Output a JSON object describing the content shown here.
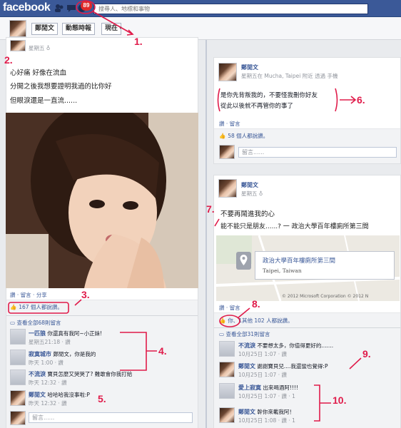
{
  "topbar": {
    "logo": "facebook",
    "notification_count": "89",
    "search_placeholder": "搜尋人、地標和事物"
  },
  "header": {
    "name": "鄭閒文",
    "tabs": [
      "動態時報",
      "現在"
    ]
  },
  "left_post": {
    "date": "星期五",
    "lines": [
      "心好痛 好像在流血",
      "分開之後我想要證明我過的比你好",
      "但眼淚還是一直流......"
    ],
    "actions": [
      "讚",
      "留言",
      "分享"
    ],
    "likes": "167 個人都說讚。",
    "view_all": "查看全部68則留言",
    "comments": [
      {
        "name": "一匹狼",
        "text": "你還真有我阿~小正妹!",
        "time": "星期五21:18 · 讚"
      },
      {
        "name": "寂寞城市",
        "text": "鄭閒文，你是我的",
        "time": "昨天 1:00 · 讚"
      },
      {
        "name": "不流淚",
        "text": "寶貝怎麼又哭哭了? 難敢會你我打給",
        "time": "昨天 12:32 · 讚"
      },
      {
        "name": "鄭閒文",
        "text": "哈哈哈我沒事啦:P",
        "time": "昨天 12:32 · 讚"
      }
    ],
    "comment_placeholder": "留言......"
  },
  "right_post1": {
    "name": "鄭閒文",
    "meta": "星期五在 Mucha, Taipei 附近 透過 手機",
    "lines": [
      "是你先背叛我的，不要怪我刪你好友",
      "從此以後就不再管你的事了"
    ],
    "actions": [
      "讚",
      "留言"
    ],
    "likes": "58 個人都說讚。",
    "comment_placeholder": "留言......"
  },
  "right_post2": {
    "name": "鄭閒文",
    "date": "星期五",
    "lines": [
      "不要再鬧進我的心",
      "能不能只是朋友......? 一 政治大學百年樓廁所第三間"
    ],
    "place_name": "政治大學百年樓廁所第三間",
    "place_city": "Taipei, Taiwan",
    "map_copyright": "© 2012 Microsoft Corporation © 2012 N",
    "actions": [
      "讚",
      "留言"
    ],
    "likes": "你、1其他 102 人都說讚。",
    "view_all": "查看全部31則留言",
    "comments": [
      {
        "name": "不流淚",
        "text": "不要想太多，你值得更好的.......",
        "time": "10月25日 1:07 · 讚"
      },
      {
        "name": "鄭閒文",
        "text": "謝謝寶貝兒....我還蠻也覺得:P",
        "time": "10月25日 1:07 · 讚"
      },
      {
        "name": "愛上寂寞",
        "text": "出來喝酒阿!!!!",
        "time": "10月25日 1:07 · 讚 · 1"
      },
      {
        "name": "鄭閒文",
        "text": "幹你來載我阿！",
        "time": "10月25日 1:08 · 讚 · 1"
      }
    ]
  },
  "annotations": [
    "1.",
    "2.",
    "3.",
    "4.",
    "5.",
    "6.",
    "7.",
    "8.",
    "9.",
    "10."
  ],
  "colors": {
    "brand": "#3b5998",
    "annotation": "#e01b4a"
  }
}
